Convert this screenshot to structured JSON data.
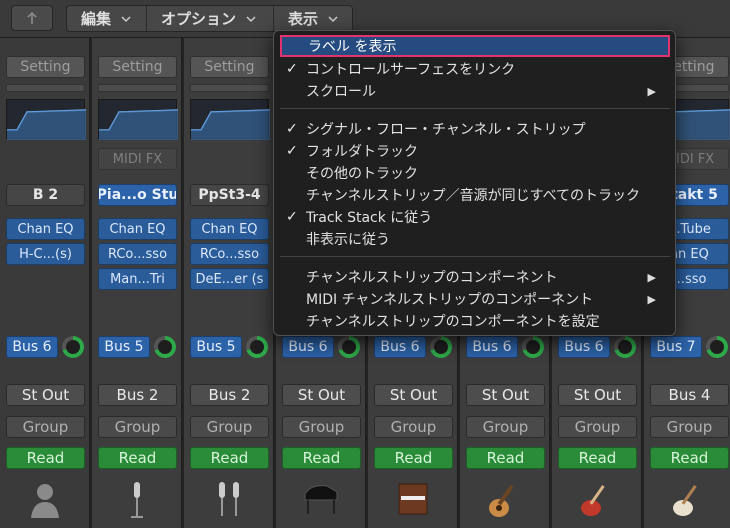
{
  "menubar": {
    "menus": [
      "編集",
      "オプション",
      "表示"
    ]
  },
  "strips": [
    {
      "setting": "Setting",
      "midi_fx": "",
      "instrument": "B 2",
      "inst_style": "dark",
      "plugins": [
        "Chan EQ",
        "H-C...(s)"
      ],
      "bus_send": "Bus 6",
      "output": "St Out",
      "group": "Group",
      "automation": "Read",
      "icon": "user-icon"
    },
    {
      "setting": "Setting",
      "midi_fx": "MIDI FX",
      "instrument": "Pia...o Stu",
      "inst_style": "blue",
      "plugins": [
        "Chan EQ",
        "RCo...sso",
        "Man...Tri"
      ],
      "bus_send": "Bus 5",
      "output": "Bus 2",
      "group": "Group",
      "automation": "Read",
      "icon": "mic-icon"
    },
    {
      "setting": "Setting",
      "midi_fx": "",
      "instrument": "PpSt3-4",
      "inst_style": "dark",
      "plugins": [
        "Chan EQ",
        "RCo...sso",
        "DeE...er (s"
      ],
      "bus_send": "Bus 5",
      "output": "Bus 2",
      "group": "Group",
      "automation": "Read",
      "icon": "stereo-mic-icon"
    },
    {
      "setting": "",
      "midi_fx": "",
      "instrument": "",
      "inst_style": "none",
      "plugins": [],
      "bus_send": "Bus 6",
      "output": "St Out",
      "group": "Group",
      "automation": "Read",
      "icon": "piano-icon"
    },
    {
      "setting": "",
      "midi_fx": "",
      "instrument": "",
      "inst_style": "none",
      "plugins": [],
      "bus_send": "Bus 6",
      "output": "St Out",
      "group": "Group",
      "automation": "Read",
      "icon": "organ-icon"
    },
    {
      "setting": "",
      "midi_fx": "",
      "instrument": "",
      "inst_style": "none",
      "plugins": [],
      "bus_send": "Bus 6",
      "output": "St Out",
      "group": "Group",
      "automation": "Read",
      "icon": "acoustic-guitar-icon"
    },
    {
      "setting": "",
      "midi_fx": "",
      "instrument": "",
      "inst_style": "none",
      "plugins": [],
      "bus_send": "Bus 6",
      "output": "St Out",
      "group": "Group",
      "automation": "Read",
      "icon": "electric-guitar-icon"
    },
    {
      "setting": "Setting",
      "midi_fx": "MIDI FX",
      "instrument": "ntakt 5",
      "inst_style": "blue",
      "plugins": [
        "...Tube",
        "an EQ",
        "...sso"
      ],
      "bus_send": "Bus 7",
      "output": "Bus 4",
      "group": "Group",
      "automation": "Read",
      "icon": "electric-guitar-2-icon"
    }
  ],
  "dropdown": {
    "items": [
      {
        "label": "ラベル を表示",
        "checked": false,
        "submenu": false,
        "highlight": true
      },
      {
        "label": "コントロールサーフェスをリンク",
        "checked": true,
        "submenu": false
      },
      {
        "label": "スクロール",
        "checked": false,
        "submenu": true
      },
      {
        "label": "シグナル・フロー・チャンネル・ストリップ",
        "checked": true,
        "submenu": false
      },
      {
        "label": "フォルダトラック",
        "checked": true,
        "submenu": false
      },
      {
        "label": "その他のトラック",
        "checked": false,
        "submenu": false
      },
      {
        "label": "チャンネルストリップ／音源が同じすべてのトラック",
        "checked": false,
        "submenu": false
      },
      {
        "label": "Track Stack に従う",
        "checked": true,
        "submenu": false
      },
      {
        "label": "非表示に従う",
        "checked": false,
        "submenu": false
      },
      {
        "label": "チャンネルストリップのコンポーネント",
        "checked": false,
        "submenu": true
      },
      {
        "label": "MIDI チャンネルストリップのコンポーネント",
        "checked": false,
        "submenu": true
      },
      {
        "label": "チャンネルストリップのコンポーネントを設定",
        "checked": false,
        "submenu": false
      }
    ],
    "check_glyph": "✓",
    "arrow_glyph": "▶"
  }
}
